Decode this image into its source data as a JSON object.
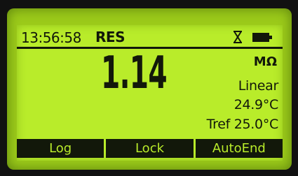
{
  "status_bar": {
    "time": "13:56:58",
    "mode": "RES",
    "icons": [
      "hourglass-icon",
      "battery-icon"
    ]
  },
  "reading": {
    "value": "1.14",
    "unit": "MΩ",
    "range_mode": "Linear",
    "temperature": "24.9°C",
    "tref": "Tref 25.0°C"
  },
  "softkeys": {
    "labels": [
      "Log",
      "Lock",
      "AutoEnd"
    ]
  },
  "colors": {
    "lcd_background": "#b9ec2a",
    "lcd_text": "#12180a",
    "bezel": "#9ccb1a"
  }
}
